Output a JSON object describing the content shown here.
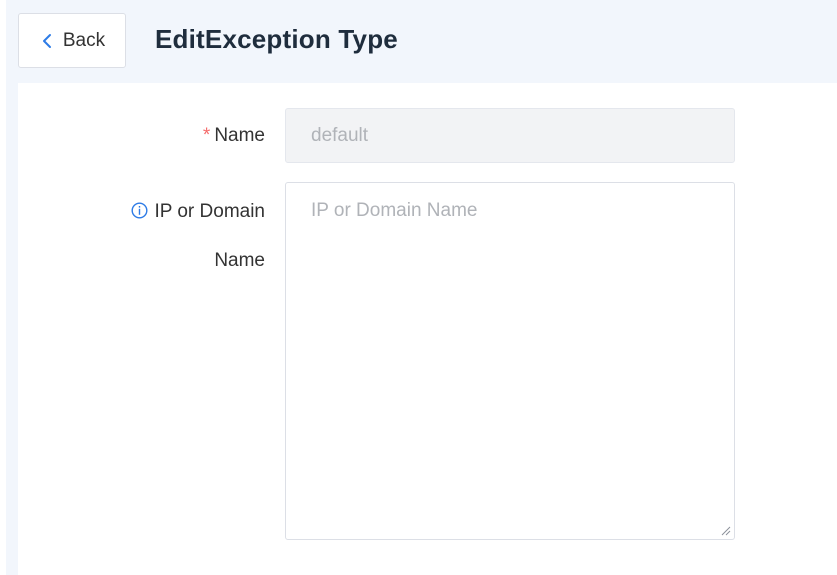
{
  "header": {
    "back_label": "Back",
    "title": "EditException Type"
  },
  "form": {
    "name": {
      "required_mark": "*",
      "label": "Name",
      "value": "default",
      "disabled": true
    },
    "ip_domain": {
      "label_line1": "IP or Domain",
      "label_line2": "Name",
      "placeholder": "IP or Domain Name",
      "value": ""
    }
  },
  "colors": {
    "header_bg": "#f2f6fc",
    "required": "#f56c6c",
    "accent": "#2d7be6",
    "disabled_bg": "#f2f3f5",
    "placeholder": "#b0b3b8"
  },
  "icons": {
    "back": "chevron-left-icon",
    "info": "info-circle-icon",
    "resize": "resize-grip-icon"
  }
}
